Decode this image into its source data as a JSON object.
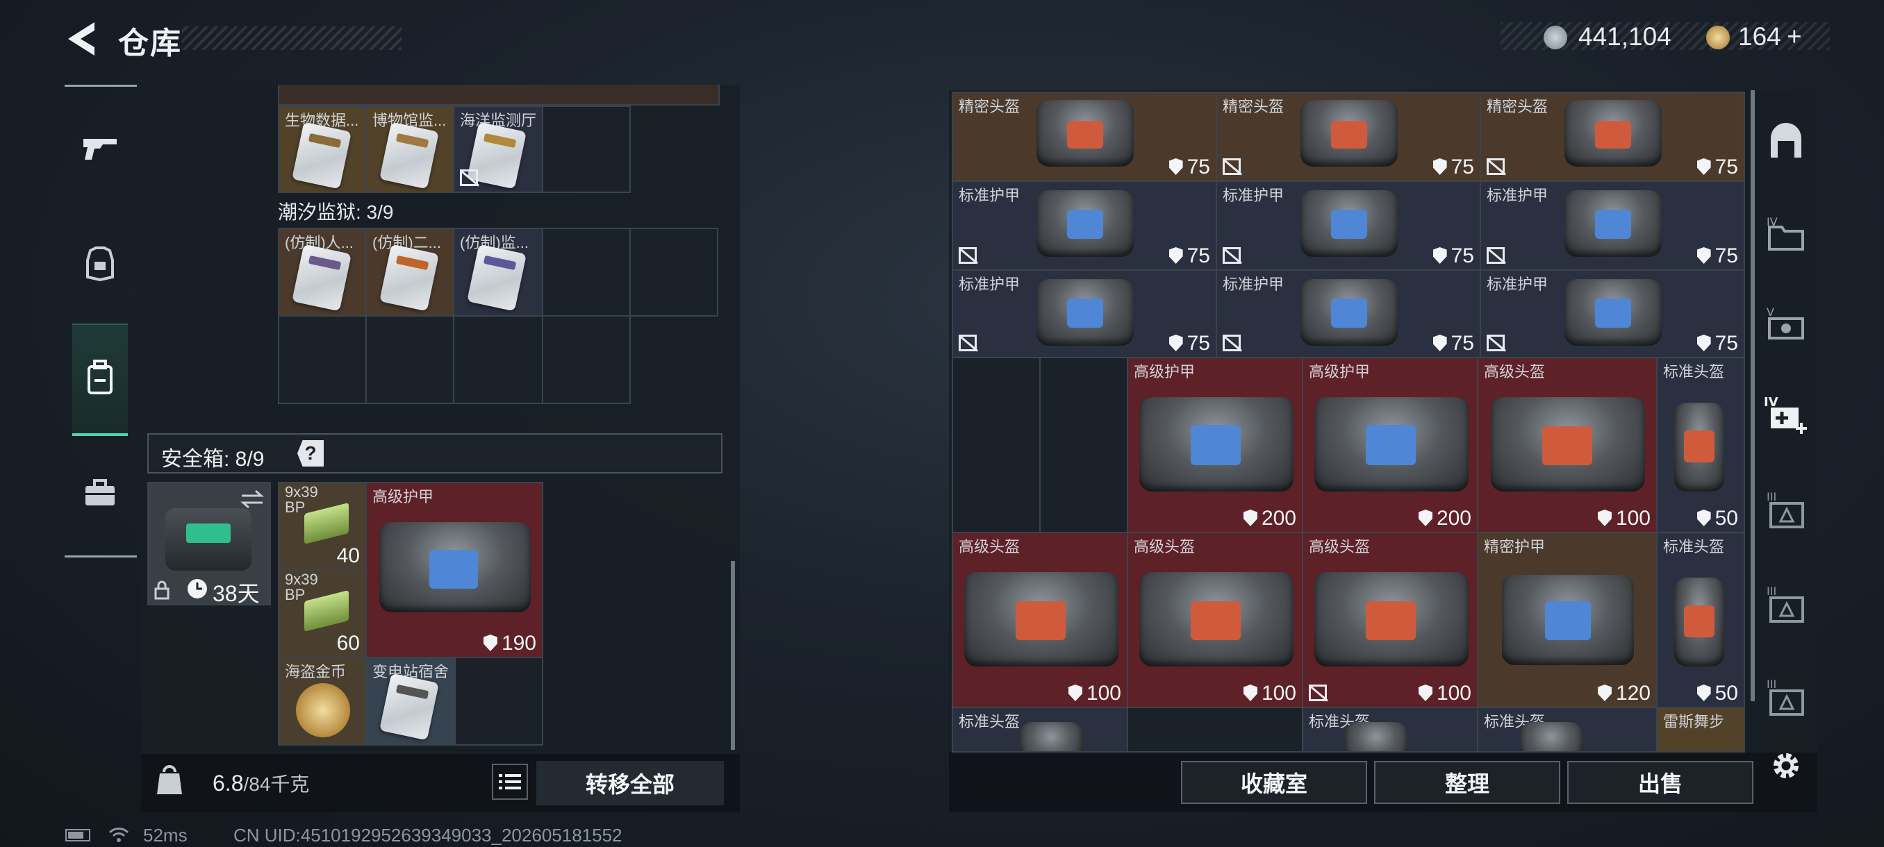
{
  "header": {
    "title": "仓库",
    "currency_main": "441,104",
    "currency_secondary": "164",
    "add_label": "+"
  },
  "sidebar": {
    "items": [
      {
        "name": "gun-icon"
      },
      {
        "name": "armor-icon"
      },
      {
        "name": "backpack-icon",
        "active": true
      },
      {
        "name": "briefcase-icon"
      }
    ]
  },
  "collection_top": {
    "items": [
      {
        "label": "生物数据...",
        "stripe": "#8a6b3a"
      },
      {
        "label": "博物馆监...",
        "stripe": "#a07a40"
      },
      {
        "label": "海洋监测厅",
        "stripe": "#b08a3a",
        "noloot": true
      }
    ]
  },
  "collection_tide": {
    "title": "潮汐监狱: 3/9",
    "items": [
      {
        "label": "(仿制)人...",
        "stripe": "#6a5a8a"
      },
      {
        "label": "(仿制)二...",
        "stripe": "#c0652a"
      },
      {
        "label": "(仿制)监...",
        "stripe": "#5a5a9a"
      }
    ]
  },
  "safe_box": {
    "title": "安全箱: 8/9",
    "help": "?",
    "duration": "38天",
    "items": [
      {
        "label": "9x39 BP",
        "count": "40"
      },
      {
        "label": "9x39 BP",
        "count": "60"
      },
      {
        "label": "高级护甲",
        "value": "190"
      },
      {
        "label": "海盗金币"
      },
      {
        "label": "变电站宿舍"
      }
    ]
  },
  "footer": {
    "weight": "6.8",
    "weight_max": "/84千克",
    "transfer_all": "转移全部"
  },
  "stash": {
    "row1": [
      {
        "label": "精密头盔",
        "value": "75"
      },
      {
        "label": "精密头盔",
        "value": "75"
      },
      {
        "label": "精密头盔",
        "value": "75"
      }
    ],
    "row2": [
      {
        "label": "标准护甲",
        "value": "75"
      },
      {
        "label": "标准护甲",
        "value": "75"
      },
      {
        "label": "标准护甲",
        "value": "75"
      }
    ],
    "row3": [
      {
        "label": "标准护甲",
        "value": "75"
      },
      {
        "label": "标准护甲",
        "value": "75"
      },
      {
        "label": "标准护甲",
        "value": "75"
      }
    ],
    "row4": [
      {
        "label": "高级护甲",
        "value": "200"
      },
      {
        "label": "高级护甲",
        "value": "200"
      },
      {
        "label": "高级头盔",
        "value": "100"
      },
      {
        "label": "标准头盔",
        "value": "50"
      }
    ],
    "row5": [
      {
        "label": "高级头盔",
        "value": "100"
      },
      {
        "label": "高级头盔",
        "value": "100"
      },
      {
        "label": "高级头盔",
        "value": "100"
      },
      {
        "label": "精密护甲",
        "value": "120"
      },
      {
        "label": "标准头盔",
        "value": "50"
      }
    ],
    "row6": [
      {
        "label": "标准头盔"
      },
      {
        "label": "标准头盔"
      },
      {
        "label": "标准头盔"
      },
      {
        "label": "雷斯舞步"
      }
    ]
  },
  "actions": {
    "collection_room": "收藏室",
    "organize": "整理",
    "sell": "出售"
  },
  "status": {
    "ping": "52ms",
    "uid": "CN UID:4510192952639349033_202605181552"
  },
  "colors": {
    "accent": "#4fd4b2",
    "rare_red": "#5e2127",
    "epic_brown": "#4b3a2c",
    "blue_navy": "#2a3040"
  }
}
